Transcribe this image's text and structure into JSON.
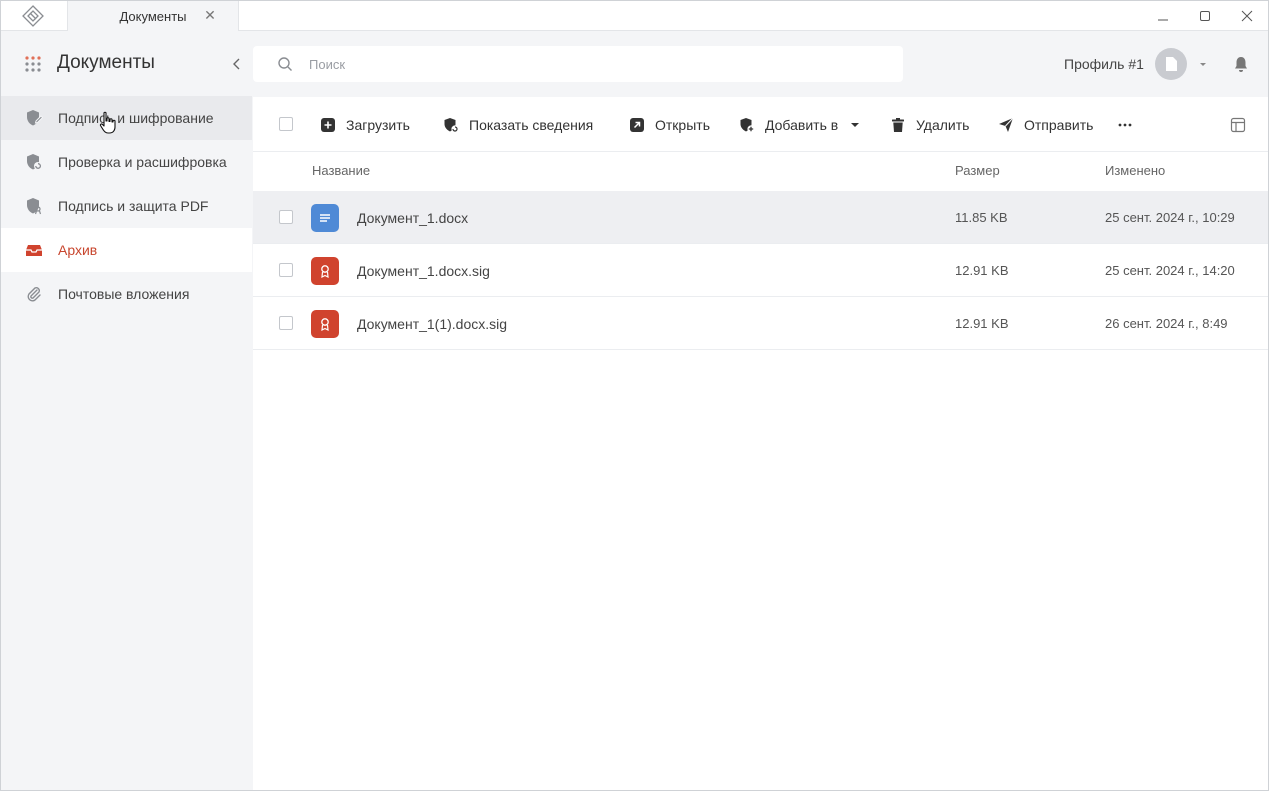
{
  "titlebar": {
    "tab_label": "Документы",
    "tab_close": "✕"
  },
  "sidebar": {
    "title": "Документы",
    "items": [
      {
        "label": "Подпись и шифрование",
        "icon": "shield-pen-icon",
        "state": "hover"
      },
      {
        "label": "Проверка и расшифровка",
        "icon": "shield-check-icon",
        "state": ""
      },
      {
        "label": "Подпись и защита PDF",
        "icon": "shield-pdf-icon",
        "state": ""
      },
      {
        "label": "Архив",
        "icon": "archive-icon",
        "state": "active"
      },
      {
        "label": "Почтовые вложения",
        "icon": "paperclip-icon",
        "state": ""
      }
    ]
  },
  "search": {
    "placeholder": "Поиск",
    "value": ""
  },
  "profile": {
    "name": "Профиль #1"
  },
  "toolbar": {
    "upload_label": "Загрузить",
    "details_label": "Показать сведения",
    "open_label": "Открыть",
    "add_to_label": "Добавить в",
    "delete_label": "Удалить",
    "send_label": "Отправить"
  },
  "table": {
    "columns": {
      "name": "Название",
      "size": "Размер",
      "modified": "Изменено"
    },
    "rows": [
      {
        "name": "Документ_1.docx",
        "size": "11.85 KB",
        "modified": "25 сент. 2024 г., 10:29",
        "type": "docx",
        "selected": true
      },
      {
        "name": "Документ_1.docx.sig",
        "size": "12.91 KB",
        "modified": "25 сент. 2024 г., 14:20",
        "type": "sig",
        "selected": false
      },
      {
        "name": "Документ_1(1).docx.sig",
        "size": "12.91 KB",
        "modified": "26 сент. 2024 г., 8:49",
        "type": "sig",
        "selected": false
      }
    ]
  },
  "colors": {
    "accent": "#c8462e",
    "docx_icon": "#4f8ad6",
    "sig_icon": "#d0432e",
    "sidebar_bg": "#f4f5f7",
    "selected_row": "#eeeff2"
  }
}
